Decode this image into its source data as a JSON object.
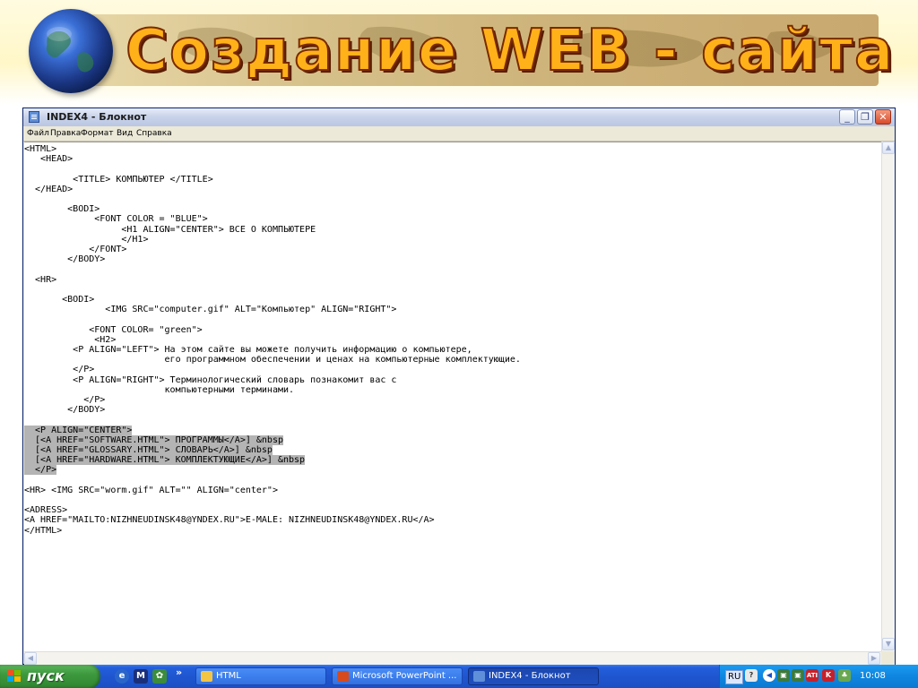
{
  "banner": {
    "title": "Создание WEB - сайта"
  },
  "window": {
    "title": "INDEX4 - Блокнот",
    "minimize": "_",
    "maximize": "❐",
    "close": "✕",
    "menu": [
      "Файл",
      "Правка",
      "Формат",
      "Вид",
      "Справка"
    ]
  },
  "editor": {
    "lines": [
      "<HTML>",
      "   <HEAD>",
      "",
      "         <TITLE> КОМПЬЮТЕР </TITLE>",
      "  </HEAD>",
      "",
      "        <BODI>",
      "             <FONT COLOR = \"BLUE\">",
      "                  <H1 ALIGN=\"CENTER\"> ВСЕ О КОМПЬЮТЕРЕ",
      "                  </H1>",
      "            </FONT>",
      "        </BODY>",
      "",
      "  <HR>",
      "",
      "       <BODI>",
      "               <IMG SRC=\"computer.gif\" ALT=\"Компьютер\" ALIGN=\"RIGHT\">",
      "",
      "            <FONT COLOR= \"green\">",
      "             <H2>",
      "         <P ALIGN=\"LEFT\"> На этом сайте вы можете получить информацию о компьютере,",
      "                          его программном обеспечении и ценах на компьютерные комплектующие.",
      "         </P>",
      "         <P ALIGN=\"RIGHT\"> Терминологический словарь познакомит вас с",
      "                          компьютерными терминами.",
      "           </P>",
      "        </BODY>",
      "",
      "  <P ALIGN=\"CENTER\">",
      "  [<A HREF=\"SOFTWARE.HTML\"> ПРОГРАММЫ</A>] &nbsp",
      "  [<A HREF=\"GLOSSARY.HTML\"> СЛОВАРЬ</A>] &nbsp",
      "  [<A HREF=\"HARDWARE.HTML\"> КОМПЛЕКТУЮЩИЕ</A>] &nbsp",
      "  </P>",
      "",
      "<HR> <IMG SRC=\"worm.gif\" ALT=\"\" ALIGN=\"center\">",
      "",
      "<ADRESS>",
      "<A HREF=\"MAILTO:NIZHNEUDINSK48@YNDEX.RU\">E-MALE: NIZHNEUDINSK48@YNDEX.RU</A>",
      "</HTML>"
    ]
  },
  "taskbar": {
    "start_label": "пуск",
    "quick_launch_more": "»",
    "tasks": [
      "HTML",
      "Microsoft PowerPoint ...",
      "INDEX4 - Блокнот"
    ],
    "language": "RU",
    "clock": "10:08"
  }
}
